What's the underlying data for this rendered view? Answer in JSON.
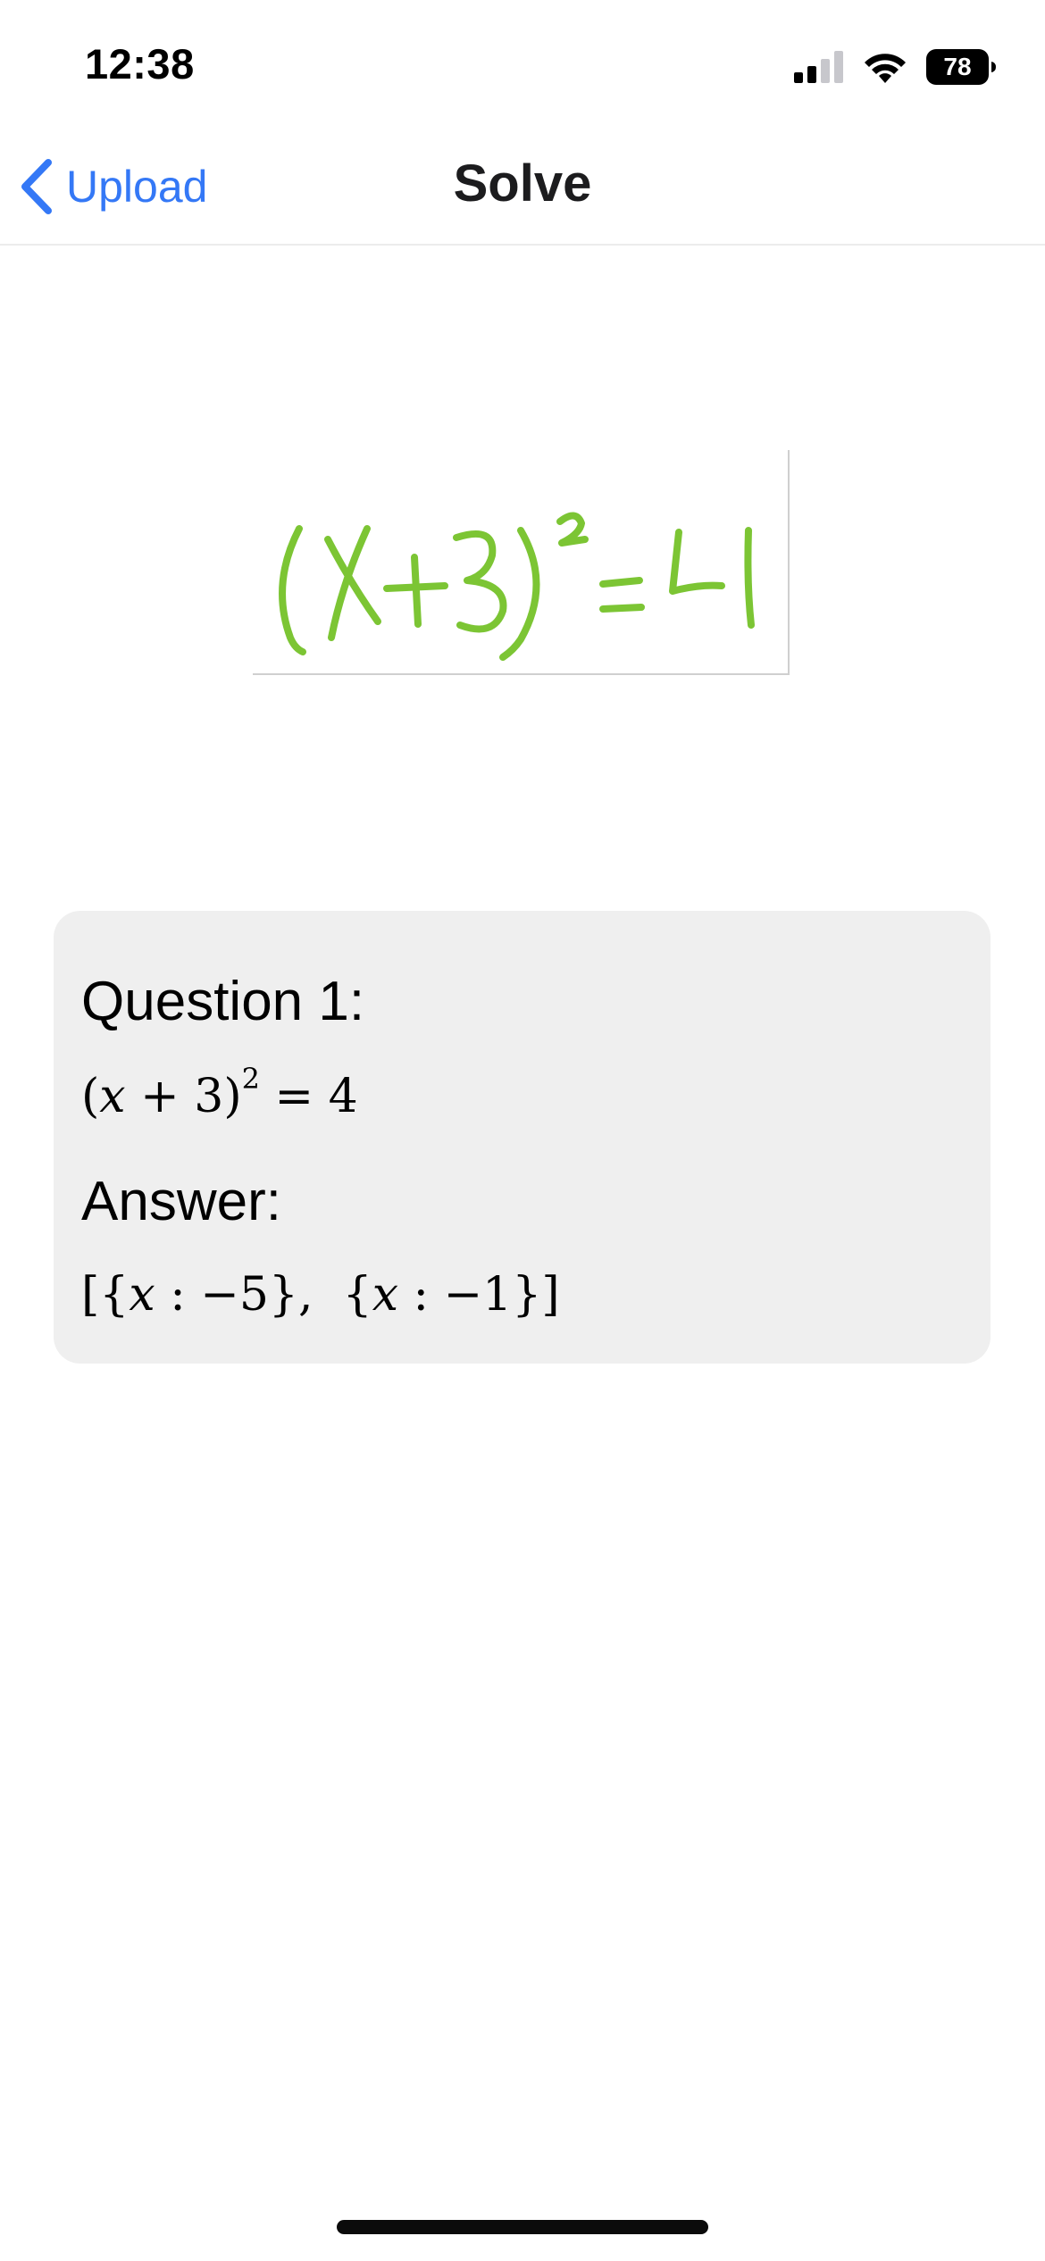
{
  "status_bar": {
    "time": "12:38",
    "battery": "78",
    "icons": [
      "signal-icon",
      "wifi-icon",
      "battery-icon"
    ]
  },
  "nav": {
    "back_label": "Upload",
    "title": "Solve",
    "accent_color": "#3478f6"
  },
  "image": {
    "handwritten_expression": "(x+3)²=4",
    "ink_color": "#7cc534"
  },
  "result": {
    "question_label": "Question 1:",
    "question_math": "(x + 3)² = 4",
    "answer_label": "Answer:",
    "answer_math": "[{x : −5}, {x : −1}]"
  }
}
